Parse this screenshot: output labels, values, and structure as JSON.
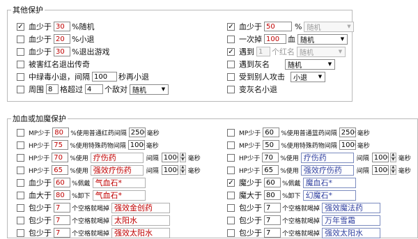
{
  "group_other": {
    "title": "其他保护",
    "left": [
      {
        "checked": true,
        "label": "血少于",
        "value": "30",
        "suffix": "%随机"
      },
      {
        "checked": false,
        "label": "血少于",
        "value": "20",
        "suffix": "%小退"
      },
      {
        "checked": false,
        "label": "血少于",
        "value": "30",
        "suffix": "%退出游戏"
      },
      {
        "checked": false,
        "label": "被害红名退出传奇"
      },
      {
        "checked": false,
        "label": "中绿毒小退，间隔",
        "value": "100",
        "suffix": "秒再小退"
      },
      {
        "checked": false,
        "label": "周围",
        "value": "8",
        "mid": "格超过",
        "value2": "4",
        "mid2": "个敌对",
        "select": "随机"
      }
    ],
    "right": [
      {
        "checked": true,
        "label": "血少于",
        "value": "50",
        "suffix": "%",
        "select": "随机",
        "select_disabled": true
      },
      {
        "checked": false,
        "label": "一次掉",
        "value": "100",
        "suffix": "血",
        "select": "随机"
      },
      {
        "checked": true,
        "label": "遇到",
        "value": "1",
        "suffix": "个红名",
        "select": "随机",
        "select_disabled": true
      },
      {
        "checked": false,
        "label": "遇到灰名",
        "select": "随机"
      },
      {
        "checked": false,
        "label": "受到别人攻击",
        "select": "小退"
      },
      {
        "checked": false,
        "label": "变灰名小退"
      }
    ]
  },
  "group_potion": {
    "title": "加血或加魔保护",
    "left": [
      {
        "label": "MP少于",
        "value": "80",
        "mid": "%使用普通红药间隔",
        "value2": "2500",
        "suffix": "毫秒"
      },
      {
        "label": "HP少于",
        "value": "75",
        "mid": "%使用特殊药物间隔",
        "value2": "1000",
        "suffix": "毫秒"
      },
      {
        "label": "HP少于",
        "value": "70",
        "mid": "%使用",
        "drug": "疗伤药",
        "mid2": "间隔",
        "value2": "1000",
        "suffix": "毫秒"
      },
      {
        "label": "HP少于",
        "value": "65",
        "mid": "%使用",
        "drug": "强效疗伤药",
        "mid2": "间隔",
        "value2": "1000",
        "suffix": "毫秒"
      },
      {
        "label": "血少于",
        "value": "60",
        "mid": "%佩戴",
        "drug": "气血石*",
        "drug_red": true
      },
      {
        "label": "血大于",
        "value": "80",
        "mid": "%卸下",
        "drug": "气血石*",
        "drug_red": true
      },
      {
        "label": "包少于",
        "value": "7",
        "mid": "个空格就喝掉",
        "drug": "强效金创药",
        "drug_red": true
      },
      {
        "label": "包少于",
        "value": "7",
        "mid": "个空格就喝掉",
        "drug": "太阳水",
        "drug_red": true
      },
      {
        "label": "包少于",
        "value": "7",
        "mid": "个空格就喝掉",
        "drug": "强效太阳水",
        "drug_red": true
      }
    ],
    "right": [
      {
        "label": "MP少于",
        "value": "60",
        "mid": "%使用普通蓝药间隔",
        "value2": "2500",
        "suffix": "毫秒"
      },
      {
        "label": "MP少于",
        "value": "50",
        "mid": "%使用特殊药物间隔",
        "value2": "1000",
        "suffix": "毫秒"
      },
      {
        "label": "HP少于",
        "value": "70",
        "mid": "%使用",
        "drug": "疗伤药",
        "mid2": "间隔",
        "value2": "1000",
        "suffix": "毫秒"
      },
      {
        "label": "HP少于",
        "value": "65",
        "mid": "%使用",
        "drug": "强效疗伤药",
        "mid2": "间隔",
        "value2": "1000",
        "suffix": "毫秒"
      },
      {
        "label": "魔少于",
        "value": "60",
        "mid": "%佩戴",
        "drug": "魔血石*",
        "checked": true
      },
      {
        "label": "魔大于",
        "value": "80",
        "mid": "%卸下",
        "drug": "幻魔石*"
      },
      {
        "label": "包少于",
        "value": "7",
        "mid": "个空格就喝掉",
        "drug": "强效魔法药"
      },
      {
        "label": "包少于",
        "value": "7",
        "mid": "个空格就喝掉",
        "drug": "万年雪霜"
      },
      {
        "label": "包少于",
        "value": "7",
        "mid": "个空格就喝掉",
        "drug": "强效太阳水"
      }
    ]
  },
  "colors": {
    "value_red": "#c00000",
    "drug_blue": "#3040a0",
    "border": "#b9b9b9"
  },
  "icons": {
    "checkbox": "check-mark",
    "dropdown": "chevron-down-icon",
    "spinner": "spin-arrows-icon"
  }
}
